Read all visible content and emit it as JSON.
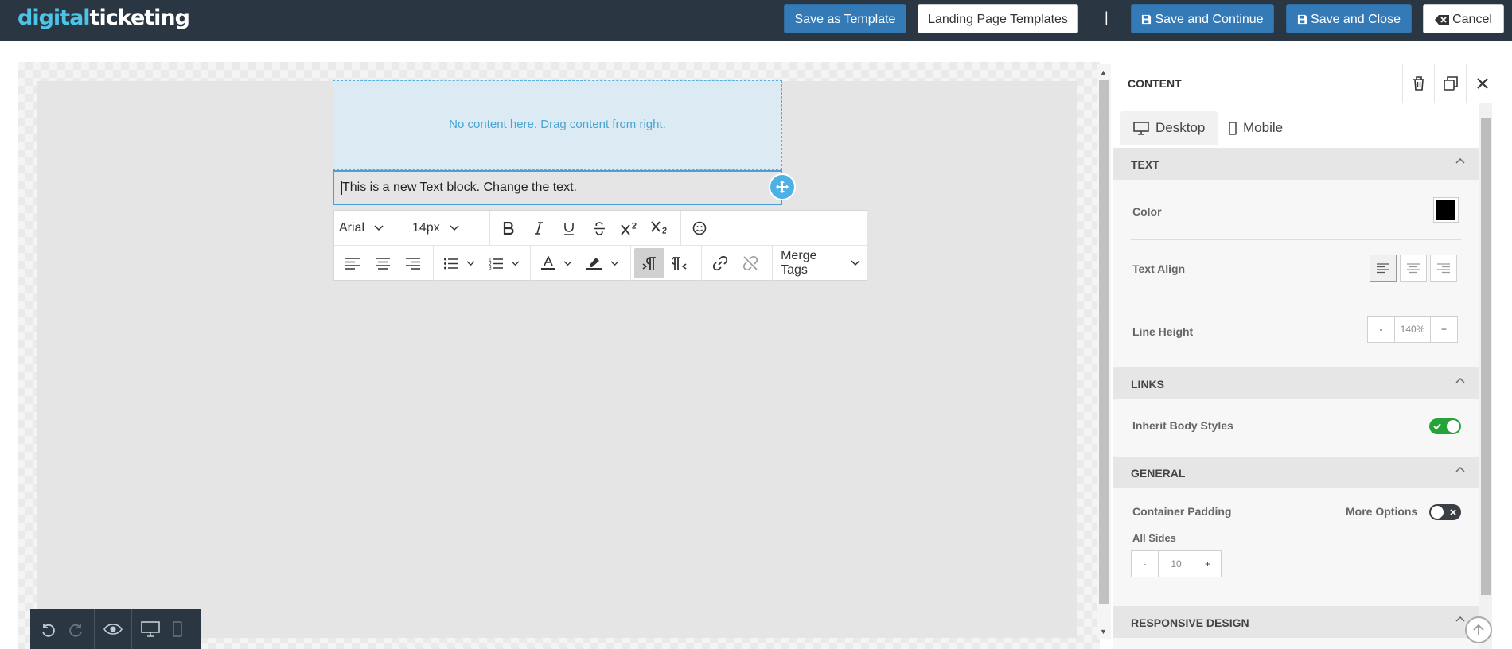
{
  "header": {
    "logo_part1": "digital",
    "logo_part2": "ticketing",
    "save_as_template": "Save as Template",
    "landing_page_templates": "Landing Page Templates",
    "separator": "|",
    "save_and_continue": "Save and Continue",
    "save_and_close": "Save and Close",
    "cancel": "Cancel"
  },
  "canvas": {
    "empty_placeholder": "No content here. Drag content from right.",
    "text_block": "This is a new Text block. Change the text."
  },
  "editor_toolbar": {
    "font_family": "Arial",
    "font_size": "14px",
    "merge_tags": "Merge Tags"
  },
  "sidebar": {
    "title": "CONTENT",
    "tabs": [
      {
        "label": "Desktop",
        "icon": "desktop-icon",
        "active": true
      },
      {
        "label": "Mobile",
        "icon": "mobile-icon",
        "active": false
      }
    ],
    "text_section": {
      "heading": "TEXT",
      "color_label": "Color",
      "color_value": "#000000",
      "text_align_label": "Text Align",
      "text_align_value": "left",
      "line_height_label": "Line Height",
      "line_height_value": "140%",
      "minus": "-",
      "plus": "+"
    },
    "links_section": {
      "heading": "LINKS",
      "inherit_label": "Inherit Body Styles",
      "inherit_on": true
    },
    "general_section": {
      "heading": "GENERAL",
      "padding_label": "Container Padding",
      "more_options_label": "More Options",
      "more_options_on": false,
      "all_sides_label": "All Sides",
      "padding_value": "10",
      "minus": "-",
      "plus": "+"
    },
    "responsive_section": {
      "heading": "RESPONSIVE DESIGN"
    }
  },
  "colors": {
    "topbar": "#2b3643",
    "primary_button": "#337ab7",
    "logo_accent": "#4ec3e8",
    "selection_border": "#4a9fd8",
    "toggle_on": "#26a338"
  }
}
